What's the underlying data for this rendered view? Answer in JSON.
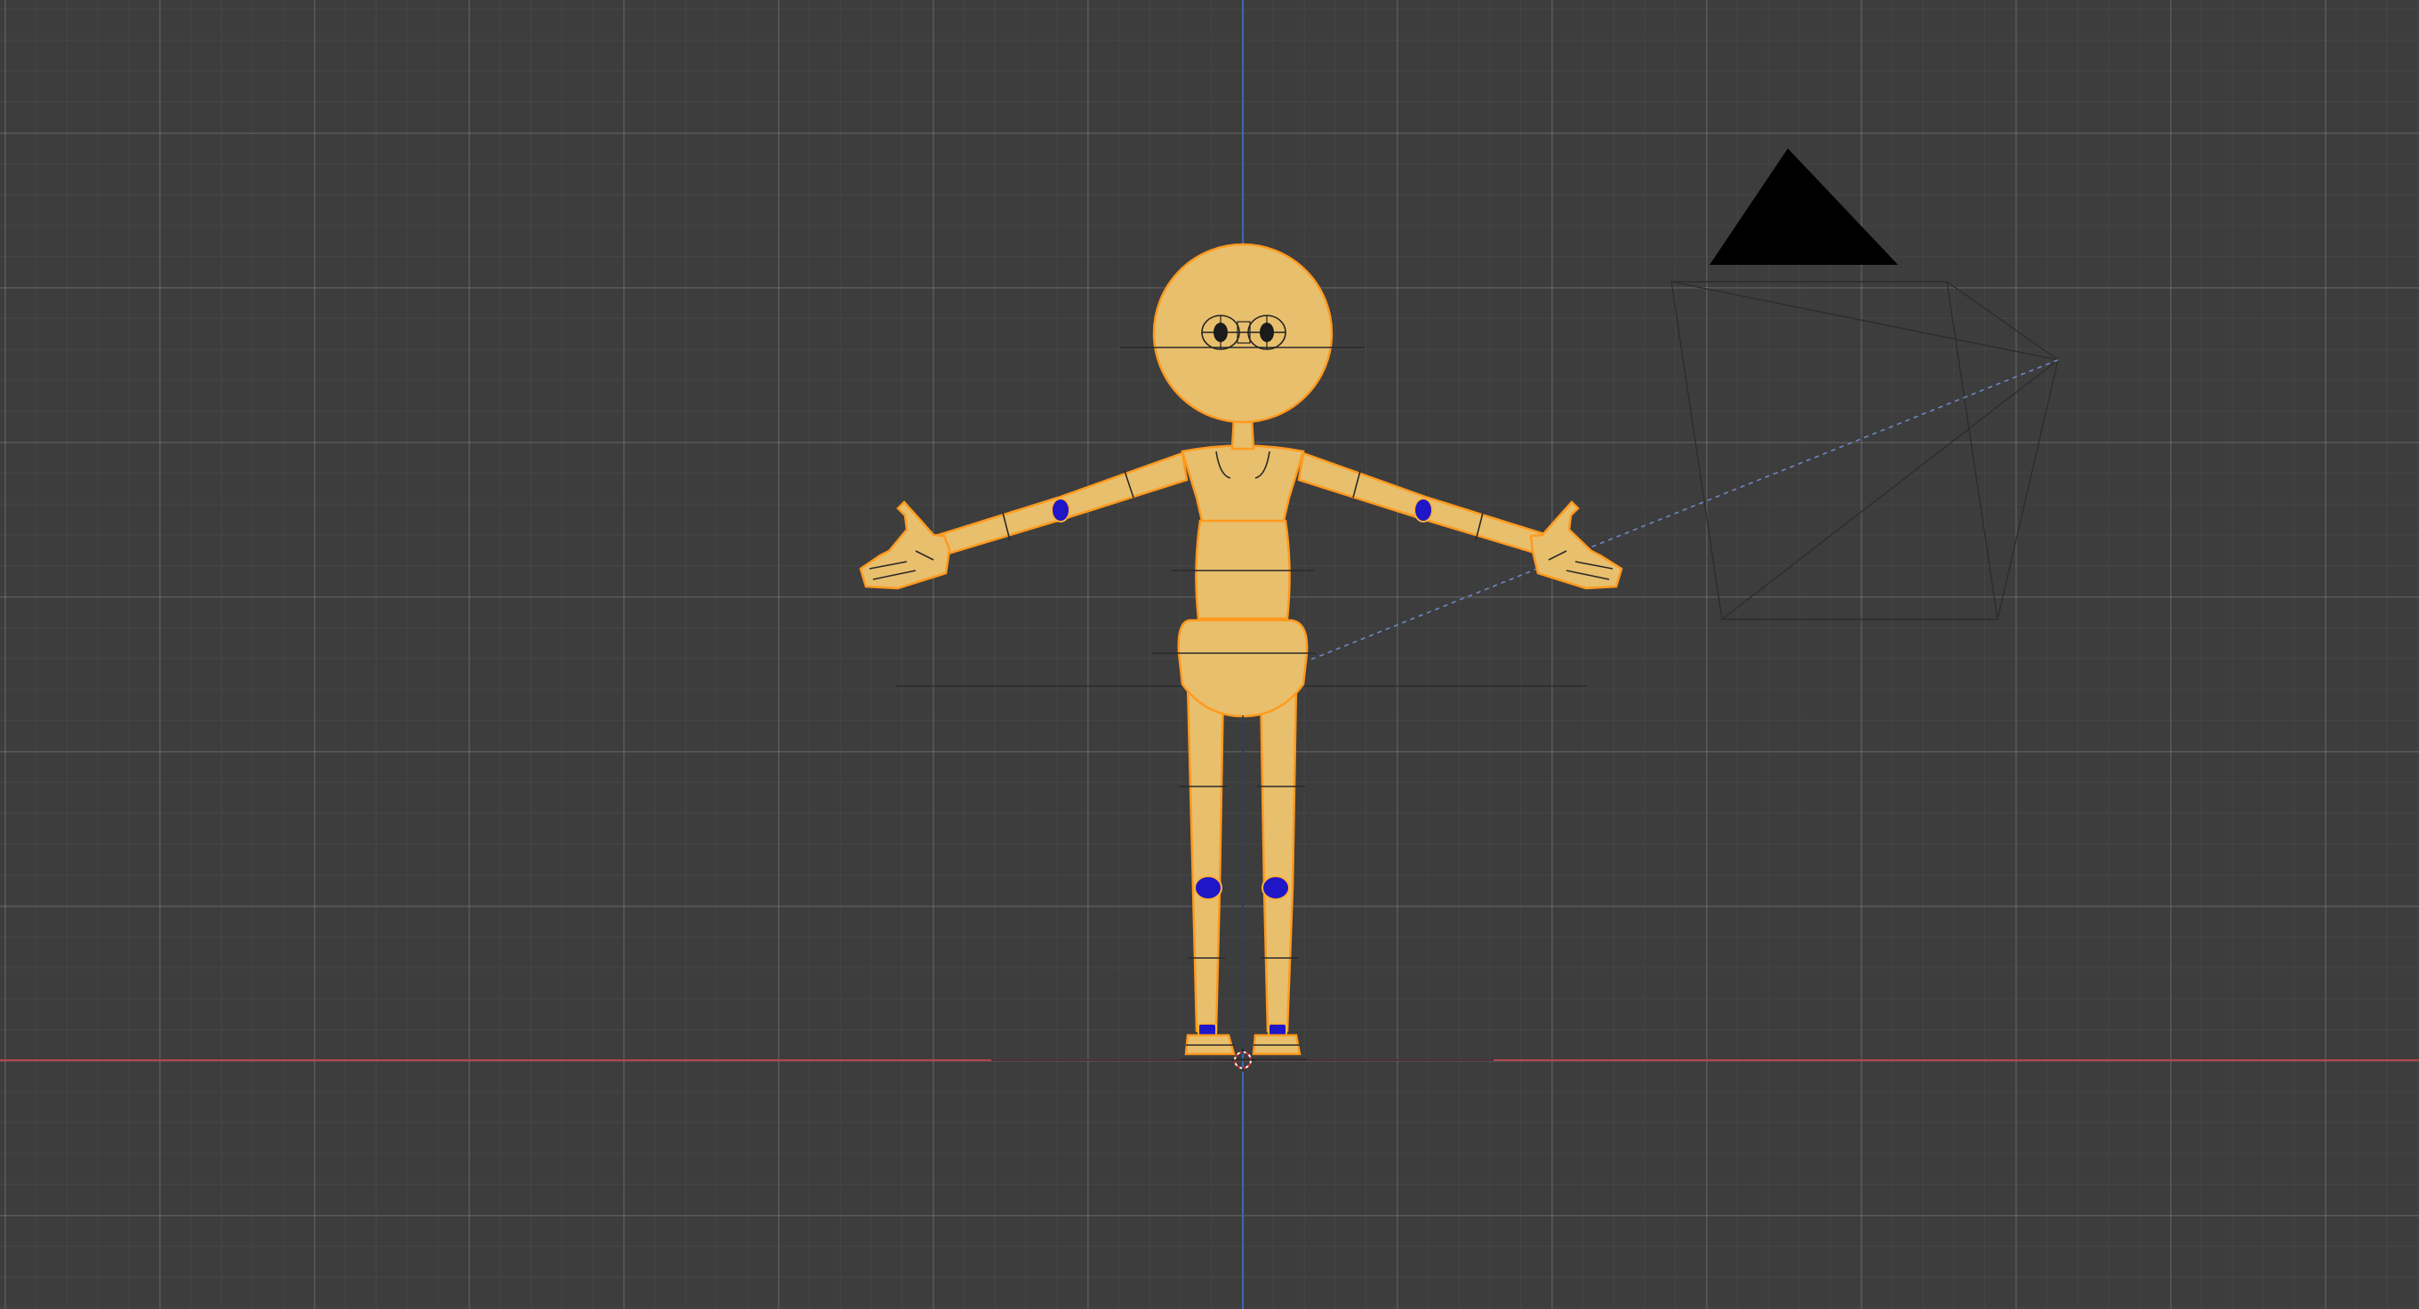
{
  "viewport": {
    "mode": "3d-viewport-front-orthographic",
    "background_color": "#3d3d3d",
    "axis_colors": {
      "x_axis": "#b54550",
      "z_axis": "#3f66b3"
    },
    "grid": true
  },
  "scene": {
    "objects": [
      {
        "name": "character",
        "type": "mesh",
        "color": "#e8bf6c",
        "selection_outline": "#ff9a1f"
      },
      {
        "name": "joints",
        "type": "mesh",
        "color": "#1f16c8"
      },
      {
        "name": "camera",
        "type": "camera"
      },
      {
        "name": "3d-cursor",
        "type": "cursor"
      }
    ]
  }
}
